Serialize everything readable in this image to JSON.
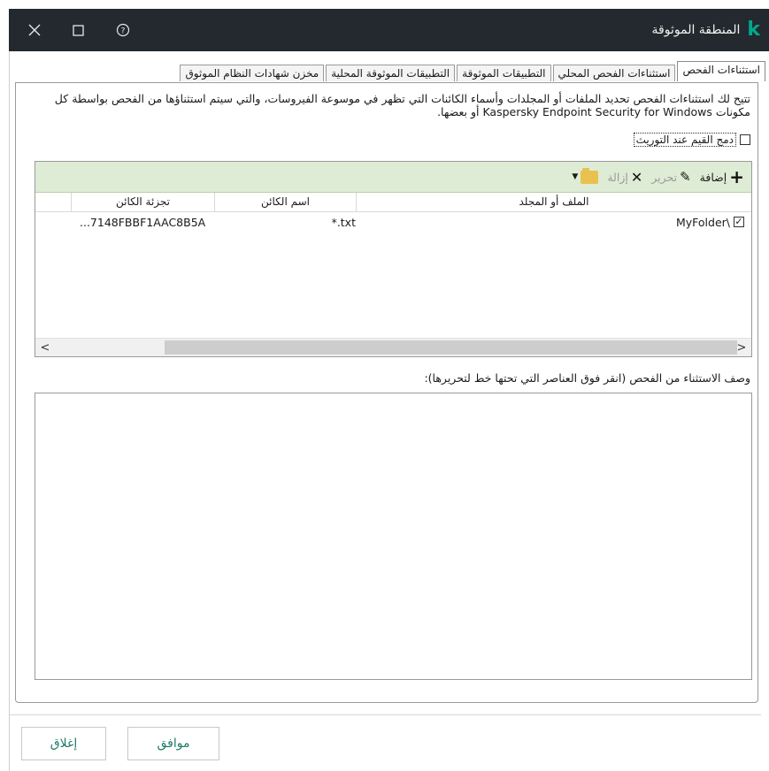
{
  "titlebar": {
    "title": "المنطقة الموثوقة",
    "logo_letter": "k",
    "close_icon": "close-icon",
    "maximize_icon": "maximize-icon",
    "help_icon": "help-icon"
  },
  "tabs": [
    {
      "label": "استثناءات الفحص",
      "active": true
    },
    {
      "label": "استثناءات الفحص المحلي",
      "active": false
    },
    {
      "label": "التطبيقات الموثوقة",
      "active": false
    },
    {
      "label": "التطبيقات الموثوقة المحلية",
      "active": false
    },
    {
      "label": "مخزن شهادات النظام الموثوق",
      "active": false
    }
  ],
  "description": "تتيح لك استثناءات الفحص تحديد الملفات أو المجلدات وأسماء الكائنات التي تظهر في موسوعة الفيروسات، والتي سيتم استثناؤها من الفحص بواسطة كل مكونات Kaspersky Endpoint Security for Windows أو بعضها.",
  "merge_checkbox": {
    "label": "دمج القيم عند التوريث",
    "checked": false
  },
  "toolbar": {
    "add_label": "إضافة",
    "edit_label": "تحرير",
    "remove_label": "إزالة"
  },
  "table": {
    "columns": [
      "الملف أو المجلد",
      "اسم الكائن",
      "تجزئة الكائن"
    ],
    "rows": [
      {
        "checked": true,
        "path": "\\MyFolder",
        "object_name": "*.txt",
        "hash": "...7148FBBF1AAC8B5A"
      }
    ]
  },
  "description_label": "وصف الاستثناء من الفحص (انقر فوق العناصر التي تحتها خط لتحريرها):",
  "buttons": {
    "ok": "موافق",
    "close": "إغلاق"
  },
  "colors": {
    "titlebar_bg": "#23292e",
    "accent": "#00a88e",
    "toolbar_bg": "#deecd6",
    "button_text": "#1e7b69"
  }
}
